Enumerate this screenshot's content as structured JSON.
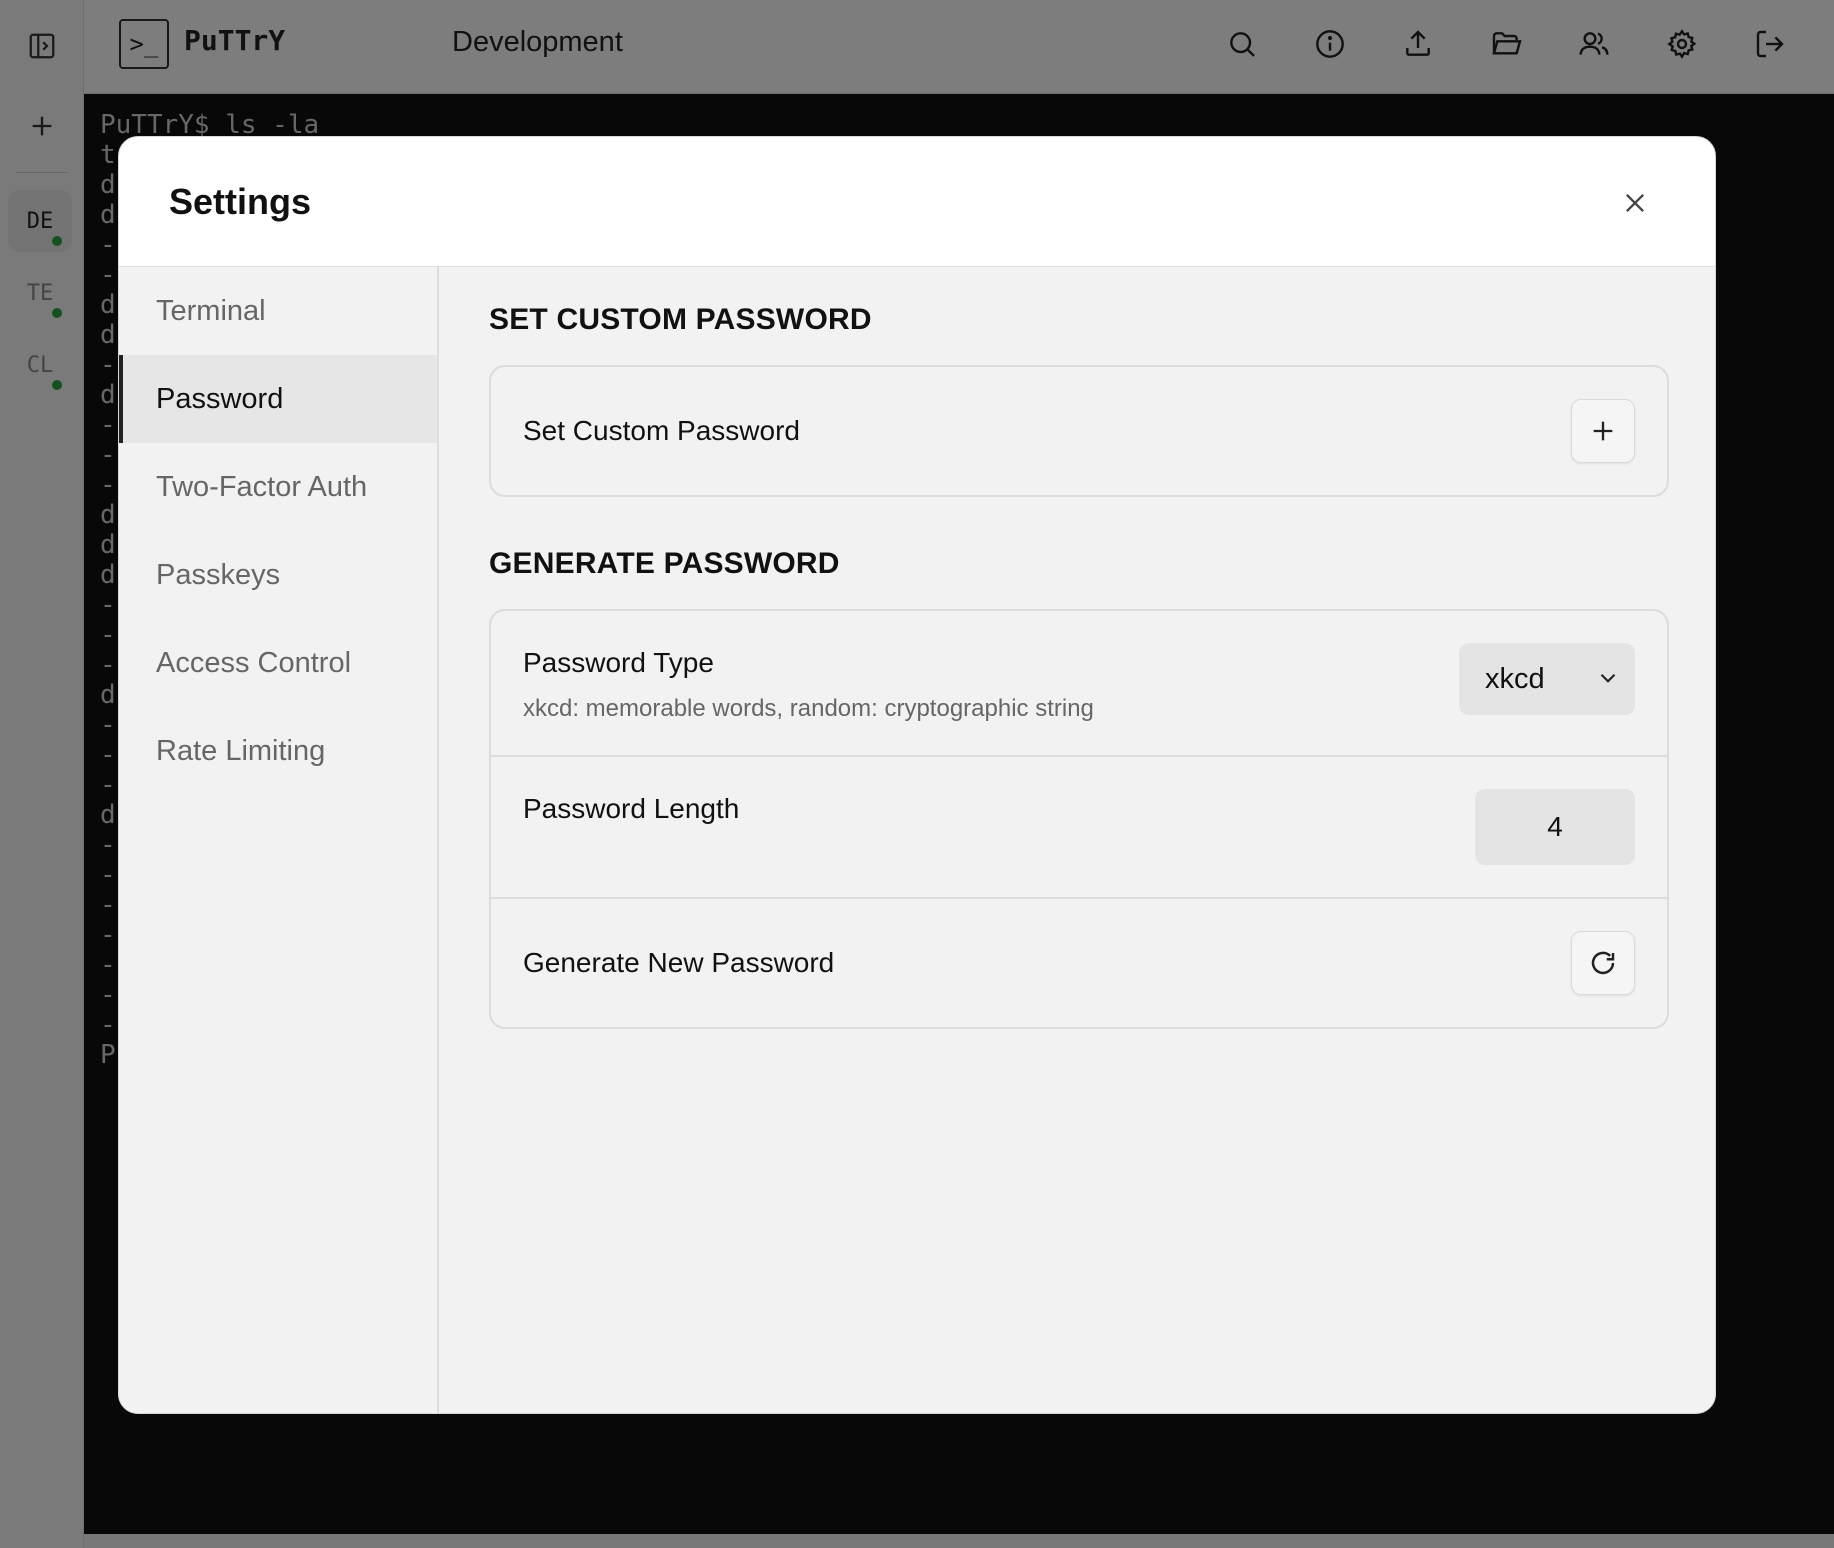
{
  "app": {
    "brand": "PuTTrY",
    "logo_glyph": ">_",
    "session_title": "Development"
  },
  "rail": {
    "sessions": [
      {
        "label": "DE",
        "active": true,
        "status": "connected"
      },
      {
        "label": "TE",
        "active": false,
        "status": "connected"
      },
      {
        "label": "CL",
        "active": false,
        "status": "connected"
      }
    ]
  },
  "topbar": {
    "icons": [
      "search-icon",
      "info-icon",
      "upload-icon",
      "folder-open-icon",
      "users-icon",
      "gear-icon",
      "logout-icon"
    ]
  },
  "terminal": {
    "lines": [
      "PuTTrY$ ls -la",
      "t",
      "d",
      "d",
      "-",
      "-",
      "d",
      "d",
      "-",
      "d",
      "-",
      "-",
      "-",
      "d",
      "d",
      "d",
      "-",
      "-",
      "-",
      "d",
      "-",
      "-",
      "-",
      "d",
      "-",
      "-",
      "-",
      "-",
      "-",
      "-",
      "-",
      "P"
    ]
  },
  "settings": {
    "title": "Settings",
    "nav": [
      {
        "label": "Terminal",
        "active": false
      },
      {
        "label": "Password",
        "active": true
      },
      {
        "label": "Two-Factor Auth",
        "active": false
      },
      {
        "label": "Passkeys",
        "active": false
      },
      {
        "label": "Access Control",
        "active": false
      },
      {
        "label": "Rate Limiting",
        "active": false
      }
    ],
    "custom_section": {
      "heading": "SET CUSTOM PASSWORD",
      "row_label": "Set Custom Password"
    },
    "generate_section": {
      "heading": "GENERATE PASSWORD",
      "type_label": "Password Type",
      "type_desc": "xkcd: memorable words, random: cryptographic string",
      "type_value": "xkcd",
      "length_label": "Password Length",
      "length_value": "4",
      "generate_label": "Generate New Password"
    }
  },
  "colors": {
    "status_dot": "#2f9e44",
    "terminal_bg": "#111111",
    "accent": "#222222"
  }
}
